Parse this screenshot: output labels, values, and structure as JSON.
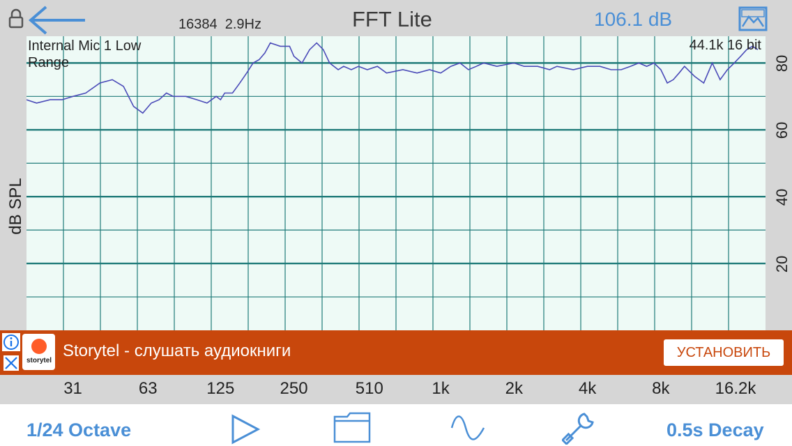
{
  "header": {
    "fft_size": "16384",
    "resolution": "2.9Hz",
    "title": "FFT Lite",
    "level": "106.1 dB",
    "icons": [
      "lock-icon",
      "back-arrow-icon",
      "image-icon"
    ]
  },
  "chart_data": {
    "type": "line",
    "xscale": "log",
    "xlabel": "",
    "ylabel": "dB SPL",
    "ylim": [
      0,
      88
    ],
    "input_label": "Internal Mic 1 Low Range",
    "format_label": "44.1k 16 bit",
    "x_tick_labels": [
      "31",
      "63",
      "125",
      "250",
      "510",
      "1k",
      "2k",
      "4k",
      "8k",
      "16.2k"
    ],
    "y_tick_labels": [
      "20",
      "40",
      "60",
      "80"
    ],
    "grid": true,
    "series": [
      {
        "color": "#4a4ab8",
        "x": [
          20,
          22,
          25,
          28,
          31,
          35,
          40,
          45,
          50,
          55,
          60,
          65,
          70,
          75,
          80,
          90,
          100,
          110,
          120,
          125,
          130,
          140,
          150,
          160,
          170,
          180,
          190,
          200,
          220,
          240,
          250,
          270,
          290,
          310,
          330,
          350,
          380,
          400,
          430,
          460,
          500,
          550,
          600,
          700,
          800,
          900,
          1000,
          1100,
          1200,
          1300,
          1400,
          1500,
          1700,
          2000,
          2200,
          2500,
          2800,
          3000,
          3500,
          4000,
          4500,
          5000,
          5500,
          6000,
          6500,
          7000,
          7500,
          8000,
          8500,
          9000,
          9500,
          10000,
          11000,
          12000,
          13000,
          14000,
          15000,
          16000,
          17000,
          18000,
          19000,
          20000
        ],
        "values": [
          69,
          68,
          69,
          69,
          70,
          71,
          74,
          75,
          73,
          67,
          65,
          68,
          69,
          71,
          70,
          70,
          69,
          68,
          70,
          69,
          71,
          71,
          74,
          77,
          80,
          81,
          83,
          86,
          85,
          85,
          82,
          80,
          84,
          86,
          84,
          80,
          78,
          79,
          78,
          79,
          78,
          79,
          77,
          78,
          77,
          78,
          77,
          79,
          80,
          78,
          79,
          80,
          79,
          80,
          79,
          79,
          78,
          79,
          78,
          79,
          79,
          78,
          78,
          79,
          80,
          79,
          80,
          78,
          74,
          75,
          77,
          79,
          76,
          74,
          80,
          75,
          78,
          80,
          82,
          84,
          85,
          84
        ]
      }
    ]
  },
  "ad": {
    "brand": "storytel",
    "text": "Storytel - слушать аудиокниги",
    "button": "УСТАНОВИТЬ",
    "icons": [
      "info-icon",
      "close-icon",
      "storytel-logo"
    ]
  },
  "bottom": {
    "octave": "1/24 Octave",
    "decay": "0.5s Decay",
    "icons": [
      "play-icon",
      "folder-icon",
      "sine-wave-icon",
      "wrench-icon"
    ]
  },
  "colors": {
    "accent": "#4a8fd6",
    "grid": "#1e7a78",
    "plot_bg": "#eefaf6",
    "ad_bg": "#c8470c"
  }
}
